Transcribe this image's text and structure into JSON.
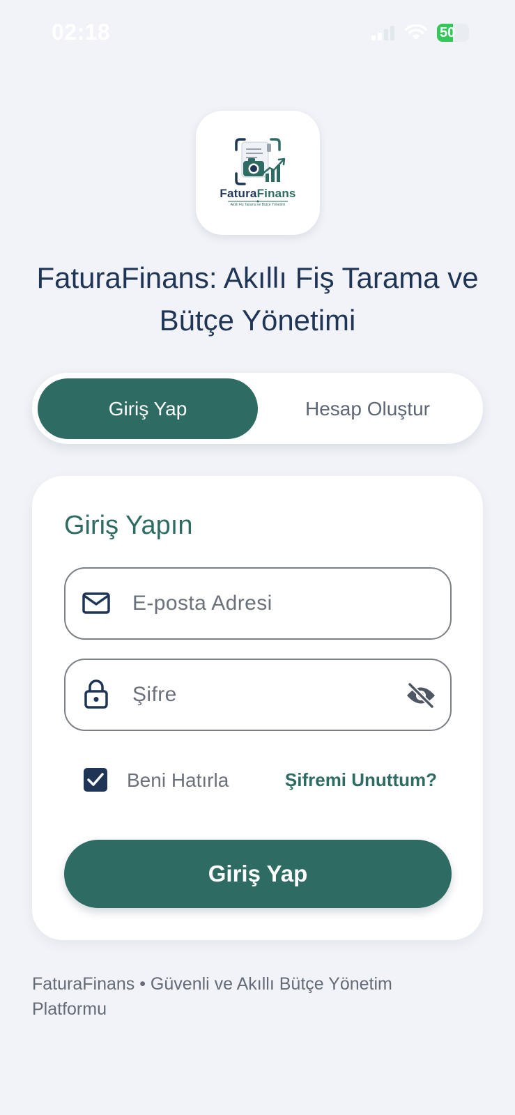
{
  "status_bar": {
    "time": "02:18",
    "battery_text": "50",
    "battery_level": 0.5
  },
  "logo": {
    "brand_part1": "Fatura",
    "brand_part2": "Finans",
    "tagline": "Akıllı Fiş Tarama ve Bütçe Yönetimi",
    "icon": "receipt-camera-chart-icon"
  },
  "app_title": "FaturaFinans: Akıllı Fiş Tarama ve Bütçe Yönetimi",
  "tabs": {
    "login": "Giriş Yap",
    "register": "Hesap Oluştur",
    "active": "login"
  },
  "login_form": {
    "title": "Giriş Yapın",
    "email_placeholder": "E-posta Adresi",
    "password_placeholder": "Şifre",
    "remember_label": "Beni Hatırla",
    "remember_checked": true,
    "forgot_label": "Şifremi Unuttum?",
    "submit_label": "Giriş Yap"
  },
  "footer": {
    "text": "FaturaFinans • Güvenli ve Akıllı Bütçe Yönetim Platformu"
  },
  "colors": {
    "primary": "#2e6b63",
    "navy": "#1f3556",
    "background": "#f1f3f8"
  }
}
